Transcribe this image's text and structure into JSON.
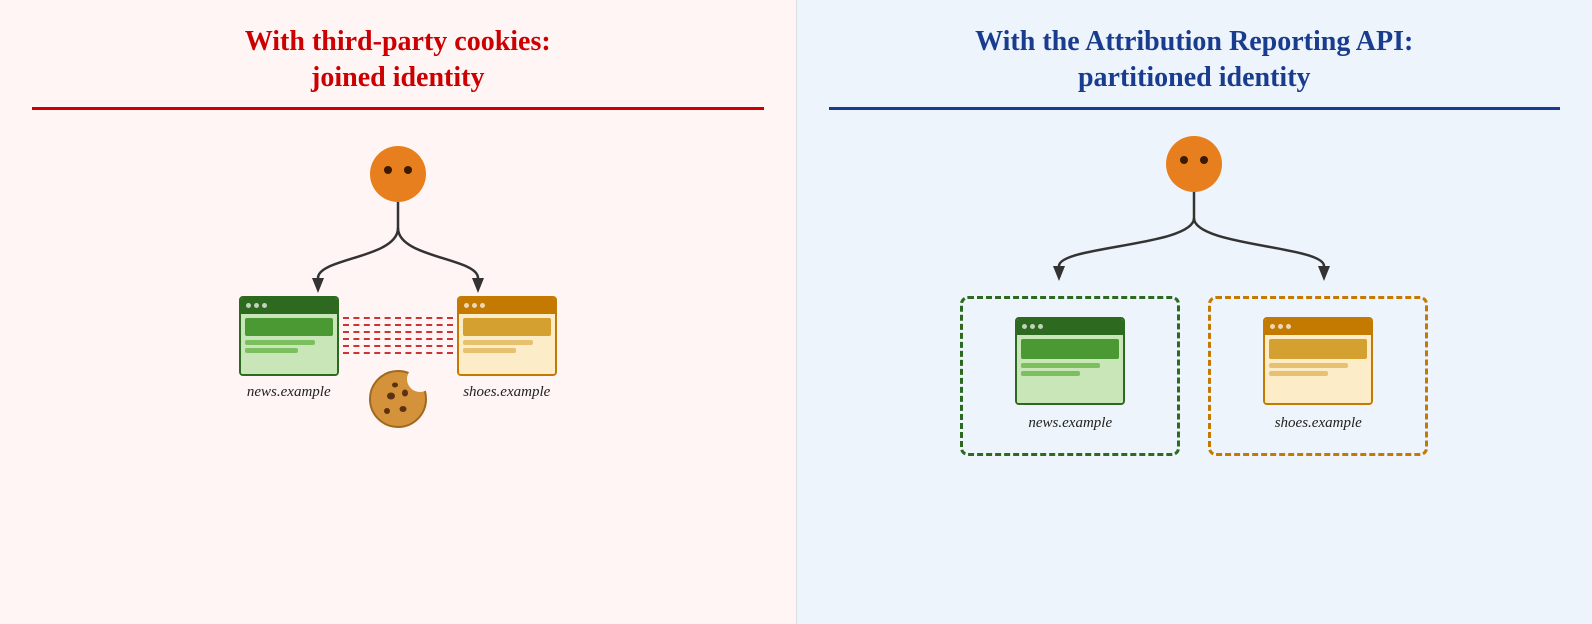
{
  "left": {
    "title_line1": "With third-party cookies:",
    "title_line2": "joined identity",
    "site1_label": "news.example",
    "site2_label": "shoes.example",
    "title_color": "#cc0000",
    "divider_color": "#cc0000",
    "bg_color": "#fff5f5"
  },
  "right": {
    "title_line1": "With the Attribution Reporting API:",
    "title_line2": "partitioned identity",
    "site1_label": "news.example",
    "site2_label": "shoes.example",
    "title_color": "#1a3c8f",
    "divider_color": "#1a3c8f",
    "bg_color": "#eef4fb"
  }
}
